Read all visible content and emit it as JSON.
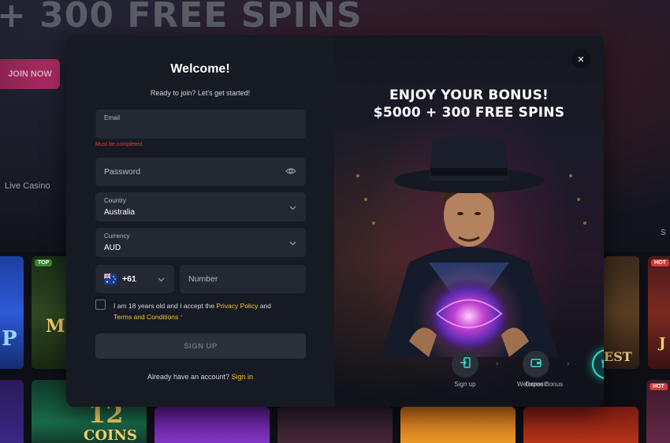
{
  "background": {
    "hero_title": "+ 300 FREE SPINS",
    "join_button": "JOIN NOW",
    "nav_live_casino": "Live Casino",
    "nav_partial": "S",
    "tile_badges": [
      "TOP",
      "HOT",
      "HOT"
    ],
    "tile_texts": [
      "P",
      "M",
      "12",
      "COINS",
      "EST",
      "J"
    ]
  },
  "form": {
    "title": "Welcome!",
    "subtitle": "Ready to join? Let's get started!",
    "email": {
      "label": "Email",
      "value": "",
      "error": "Must be completed"
    },
    "password": {
      "placeholder": "Password"
    },
    "country": {
      "label": "Country",
      "value": "Australia"
    },
    "currency": {
      "label": "Currency",
      "value": "AUD"
    },
    "phone": {
      "code": "+61",
      "number_placeholder": "Number"
    },
    "terms": {
      "prefix": "I am 18 years old and I accept the ",
      "privacy": "Privacy Policy",
      "and": " and",
      "terms_link": "Terms and Conditions",
      "required": " *"
    },
    "signup_button": "SIGN UP",
    "already_text": "Already have an account? ",
    "signin_link": "Sign in"
  },
  "promo": {
    "line1": "ENJOY YOUR BONUS!",
    "line2": "$5000 + 300 FREE SPINS",
    "steps": [
      {
        "label": "Sign up",
        "icon": "login-icon"
      },
      {
        "label": "Deposit",
        "icon": "wallet-icon"
      },
      {
        "label": "Welcome Bonus",
        "icon": "gift-icon"
      }
    ]
  },
  "colors": {
    "accent_link": "#f2c62f",
    "error": "#e53a3a",
    "active_step": "#28e0d0",
    "join_button": "#b02c63"
  }
}
